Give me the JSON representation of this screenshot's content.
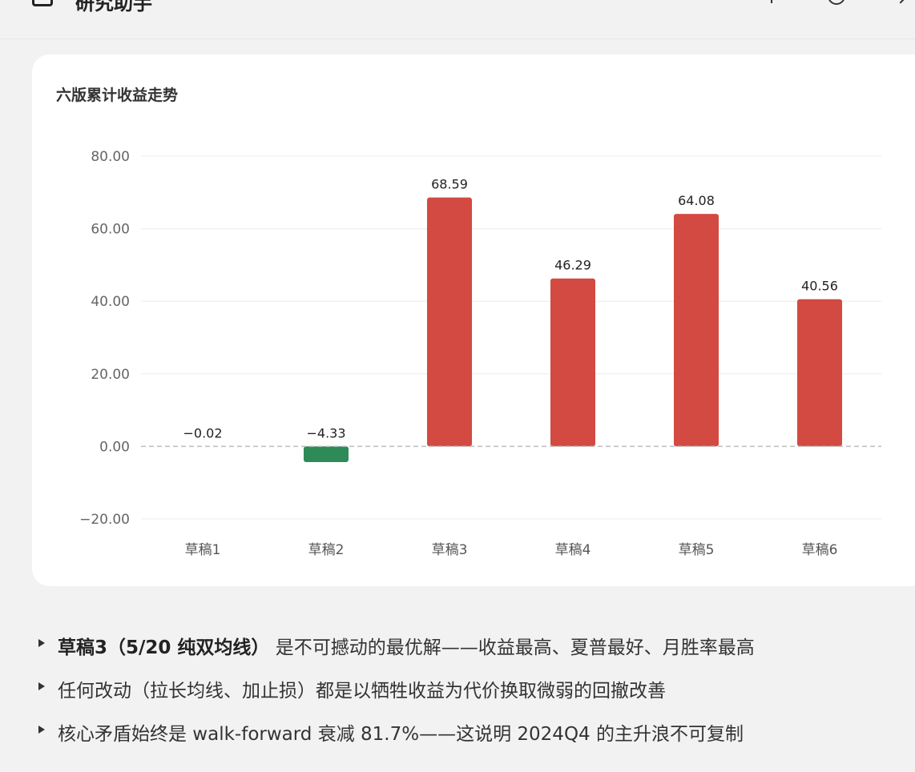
{
  "header": {
    "title": "研究助手",
    "icons": [
      "document-icon",
      "pin-icon",
      "clock-icon",
      "chevron-icon"
    ]
  },
  "chart_data": {
    "type": "bar",
    "title": "六版累计收益走势",
    "xlabel": "",
    "ylabel": "",
    "categories": [
      "草稿1",
      "草稿2",
      "草稿3",
      "草稿4",
      "草稿5",
      "草稿6"
    ],
    "values": [
      -0.02,
      -4.33,
      68.59,
      46.29,
      64.08,
      40.56
    ],
    "value_labels": [
      "−0.02",
      "−4.33",
      "68.59",
      "46.29",
      "64.08",
      "40.56"
    ],
    "ylim": [
      -20,
      80
    ],
    "yticks": [
      80,
      60,
      40,
      20,
      0,
      -20
    ],
    "ytick_labels": [
      "80.00",
      "60.00",
      "40.00",
      "20.00",
      "0.00",
      "−20.00"
    ],
    "grid": true,
    "zero_line": "dashed",
    "colors": {
      "positive": "#d24a41",
      "negative": "#2e8b57"
    }
  },
  "bullets": [
    {
      "bold": "草稿3（5/20 纯双均线）",
      "text": "是不可撼动的最优解——收益最高、夏普最好、月胜率最高"
    },
    {
      "bold": "",
      "text": "任何改动（拉长均线、加止损）都是以牺牲收益为代价换取微弱的回撤改善"
    },
    {
      "bold": "",
      "text": "核心矛盾始终是 walk-forward 衰减 81.7%——这说明 2024Q4 的主升浪不可复制"
    }
  ]
}
